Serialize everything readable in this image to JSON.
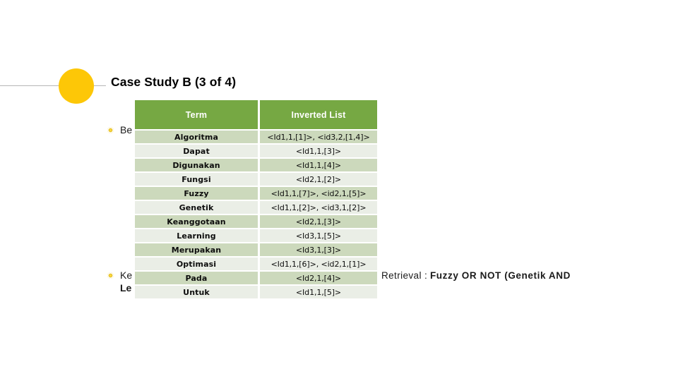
{
  "slide": {
    "title": "Case Study B (3 of 4)",
    "accent_gold": "#fdc707",
    "accent_green": "#76a843",
    "row_shade_dark": "#ccd9bc",
    "row_shade_light": "#eaeee6"
  },
  "bullets": [
    {
      "line1": "Be",
      "line2": ""
    },
    {
      "line1": "Ke",
      "line2": "Le"
    }
  ],
  "retrieval": {
    "label": "Retrieval  :",
    "expression": "Fuzzy  OR  NOT  (Genetik  AND"
  },
  "table": {
    "headers": [
      "Term",
      "Inverted List"
    ],
    "rows": [
      {
        "term": "Algoritma",
        "list": "<Id1,1,[1]>, <id3,2,[1,4]>"
      },
      {
        "term": "Dapat",
        "list": "<Id1,1,[3]>"
      },
      {
        "term": "Digunakan",
        "list": "<Id1,1,[4]>"
      },
      {
        "term": "Fungsi",
        "list": "<Id2,1,[2]>"
      },
      {
        "term": "Fuzzy",
        "list": "<Id1,1,[7]>, <id2,1,[5]>"
      },
      {
        "term": "Genetik",
        "list": "<Id1,1,[2]>, <id3,1,[2]>"
      },
      {
        "term": "Keanggotaan",
        "list": "<Id2,1,[3]>"
      },
      {
        "term": "Learning",
        "list": "<Id3,1,[5]>"
      },
      {
        "term": "Merupakan",
        "list": "<Id3,1,[3]>"
      },
      {
        "term": "Optimasi",
        "list": "<Id1,1,[6]>, <id2,1,[1]>"
      },
      {
        "term": "Pada",
        "list": "<Id2,1,[4]>"
      },
      {
        "term": "Untuk",
        "list": "<Id1,1,[5]>"
      }
    ]
  }
}
